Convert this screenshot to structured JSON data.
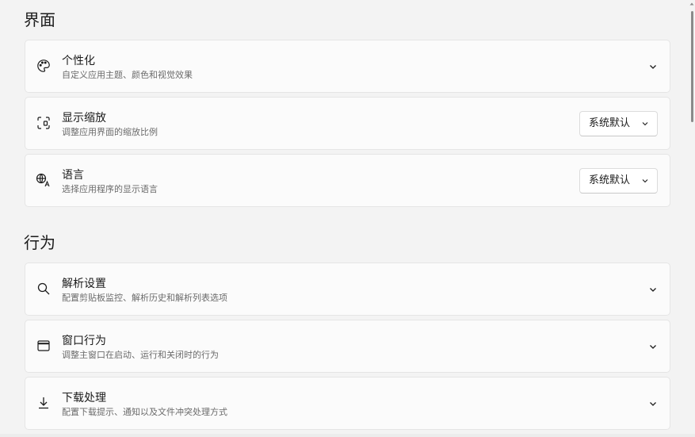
{
  "sections": [
    {
      "title": "界面",
      "items": [
        {
          "icon": "palette-icon",
          "title": "个性化",
          "desc": "自定义应用主题、颜色和视觉效果",
          "control": "chevron"
        },
        {
          "icon": "display-scale-icon",
          "title": "显示缩放",
          "desc": "调整应用界面的缩放比例",
          "control": "dropdown",
          "value": "系统默认"
        },
        {
          "icon": "language-icon",
          "title": "语言",
          "desc": "选择应用程序的显示语言",
          "control": "dropdown",
          "value": "系统默认"
        }
      ]
    },
    {
      "title": "行为",
      "items": [
        {
          "icon": "search-icon",
          "title": "解析设置",
          "desc": "配置剪贴板监控、解析历史和解析列表选项",
          "control": "chevron"
        },
        {
          "icon": "window-icon",
          "title": "窗口行为",
          "desc": "调整主窗口在启动、运行和关闭时的行为",
          "control": "chevron"
        },
        {
          "icon": "download-icon",
          "title": "下载处理",
          "desc": "配置下载提示、通知以及文件冲突处理方式",
          "control": "chevron"
        }
      ]
    }
  ],
  "colors": {
    "background": "#f3f3f3",
    "card": "#fbfbfb",
    "border": "#e5e5e5",
    "secondary_text": "#6b6b6b"
  }
}
